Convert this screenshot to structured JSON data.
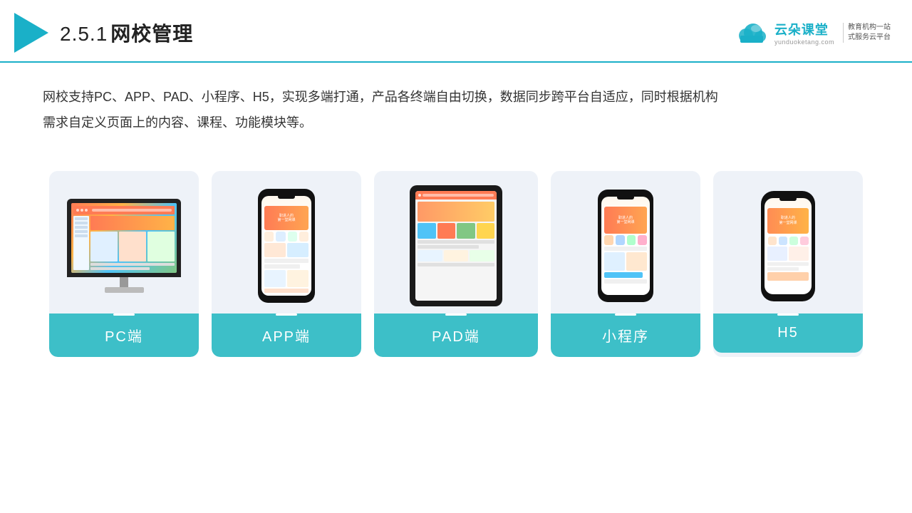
{
  "header": {
    "section_number": "2.5.1",
    "title": "网校管理",
    "brand": {
      "name": "云朵课堂",
      "domain": "yunduoketang.com",
      "slogan_line1": "教育机构一站",
      "slogan_line2": "式服务云平台"
    }
  },
  "description": "网校支持PC、APP、PAD、小程序、H5，实现多端打通，产品各终端自由切换，数据同步跨平台自适应，同时根据机构",
  "description2": "需求自定义页面上的内容、课程、功能模块等。",
  "cards": [
    {
      "id": "pc",
      "label": "PC端"
    },
    {
      "id": "app",
      "label": "APP端"
    },
    {
      "id": "pad",
      "label": "PAD端"
    },
    {
      "id": "miniprogram",
      "label": "小程序"
    },
    {
      "id": "h5",
      "label": "H5"
    }
  ],
  "colors": {
    "accent": "#1ab0c8",
    "card_bg": "#eef2f8",
    "label_bg": "#3dbfc8"
  }
}
